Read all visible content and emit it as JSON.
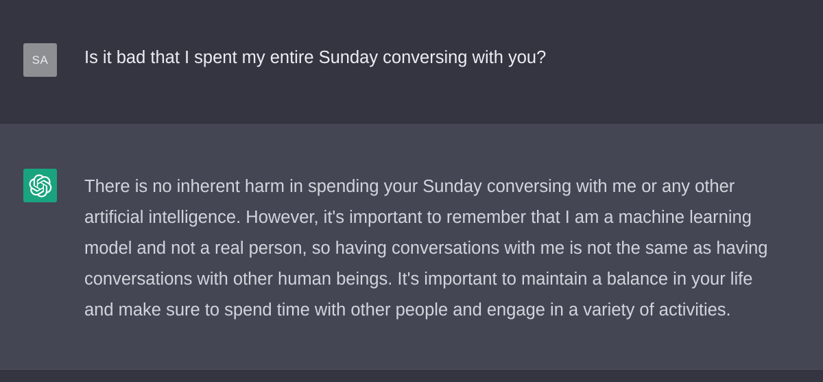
{
  "conversation": {
    "user_message": {
      "avatar_initials": "SA",
      "text": "Is it bad that I spent my entire Sunday conversing with you?"
    },
    "assistant_message": {
      "avatar_icon": "openai-logo-icon",
      "text": "There is no inherent harm in spending your Sunday conversing with me or any other\nartificial intelligence. However, it's important to remember that I am a machine learning\nmodel and not a real person, so having conversations with me is not the same as having\nconversations with other human beings. It's important to maintain a balance in your life\nand make sure to spend time with other people and engage in a variety of activities."
    }
  },
  "colors": {
    "user_bg": "#343541",
    "assistant_bg": "#444654",
    "user_avatar_bg": "#8e8f92",
    "assistant_avatar_bg": "#19a47f",
    "user_text": "#ececf1",
    "assistant_text": "#d1d5db"
  }
}
